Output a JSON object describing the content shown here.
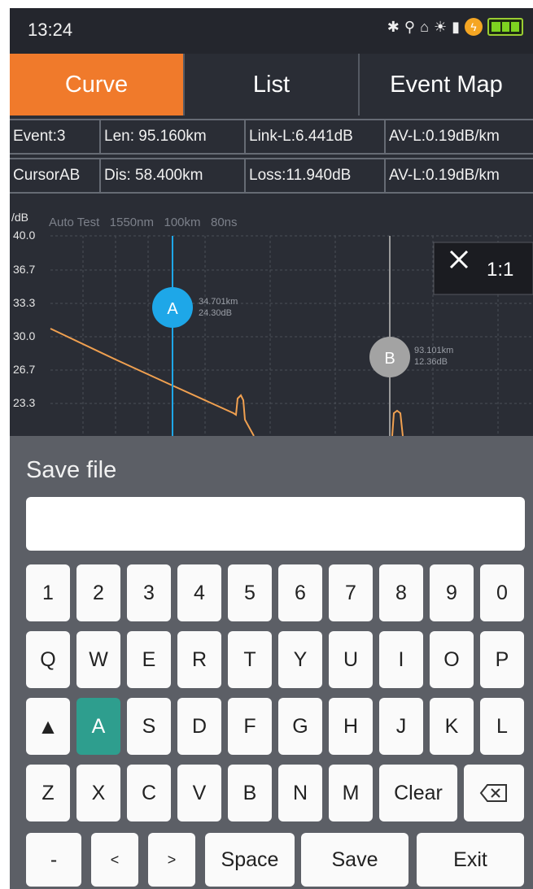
{
  "status": {
    "time": "13:24"
  },
  "tabs": [
    {
      "label": "Curve",
      "active": true
    },
    {
      "label": "List"
    },
    {
      "label": "Event Map"
    }
  ],
  "info": {
    "row1": [
      "Event:3",
      "Len: 95.160km",
      "Link-L:6.441dB",
      "AV-L:0.19dB/km"
    ],
    "row2": [
      "CursorAB",
      "Dis: 58.400km",
      "Loss:11.940dB",
      "AV-L:0.19dB/km"
    ]
  },
  "graph": {
    "unit": "/dB",
    "test_info": "Auto Test   1550nm   100km   80ns",
    "y_ticks": [
      "40.0",
      "36.7",
      "33.3",
      "30.0",
      "26.7",
      "23.3"
    ],
    "cursor_a": {
      "label": "A",
      "dist": "34.701km",
      "db": "24.30dB"
    },
    "cursor_b": {
      "label": "B",
      "dist": "93.101km",
      "db": "12.36dB"
    },
    "zoom_label": "1:1",
    "colors": {
      "trace": "#f0a050",
      "cursor_a": "#1ea7e8",
      "cursor_b": "#9a9a9a"
    }
  },
  "dialog": {
    "title": "Save file",
    "input_value": "",
    "keys": {
      "row_numbers": [
        "1",
        "2",
        "3",
        "4",
        "5",
        "6",
        "7",
        "8",
        "9",
        "0"
      ],
      "row_q": [
        "Q",
        "W",
        "E",
        "R",
        "T",
        "Y",
        "U",
        "I",
        "O",
        "P"
      ],
      "row_a": [
        "A",
        "S",
        "D",
        "F",
        "G",
        "H",
        "J",
        "K",
        "L"
      ],
      "row_z": [
        "Z",
        "X",
        "C",
        "V",
        "B",
        "N",
        "M"
      ],
      "clear": "Clear",
      "dash": "-",
      "lt": "<",
      "gt": ">",
      "space": "Space",
      "save": "Save",
      "exit": "Exit",
      "selected_key": "A"
    }
  }
}
